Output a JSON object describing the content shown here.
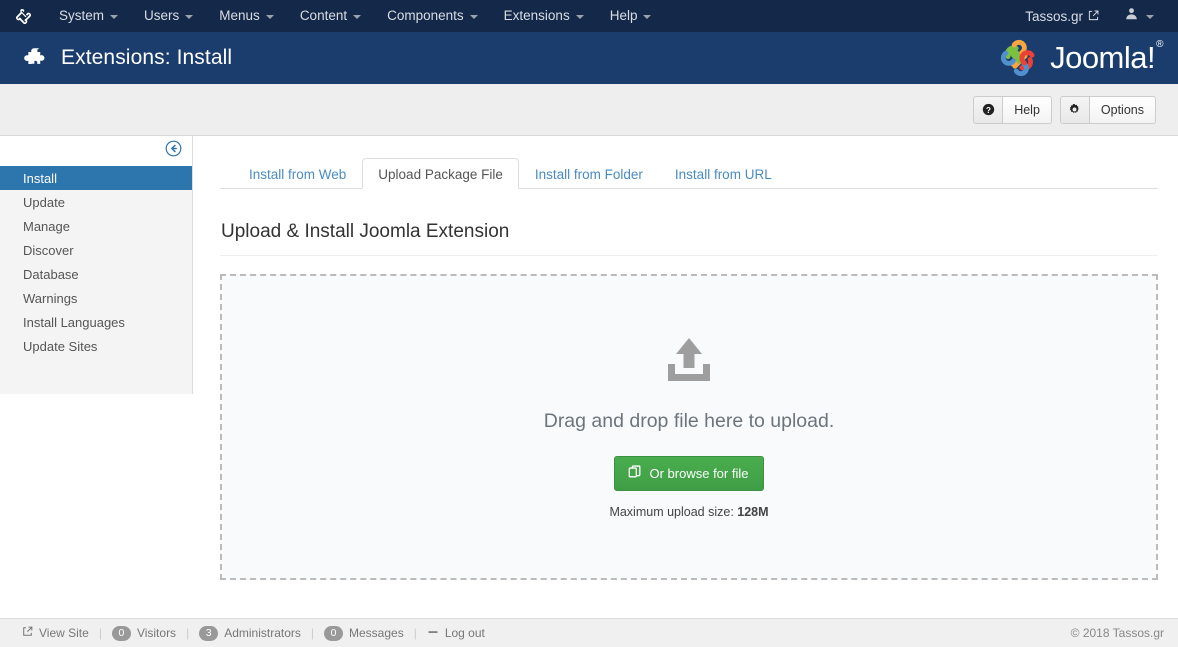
{
  "topnav": {
    "brand_icon": "joomla-mark-icon",
    "items": [
      {
        "label": "System",
        "has_caret": true
      },
      {
        "label": "Users",
        "has_caret": true
      },
      {
        "label": "Menus",
        "has_caret": true
      },
      {
        "label": "Content",
        "has_caret": true
      },
      {
        "label": "Components",
        "has_caret": true
      },
      {
        "label": "Extensions",
        "has_caret": true
      },
      {
        "label": "Help",
        "has_caret": true
      }
    ],
    "site_link": "Tassos.gr",
    "site_link_icon": "external-link-icon",
    "user_icon": "user-avatar-icon"
  },
  "header": {
    "icon": "puzzle-piece-icon",
    "title": "Extensions: Install",
    "logo_text": "Joomla!",
    "logo_registered": "®"
  },
  "toolbar": {
    "help_label": "Help",
    "help_icon": "question-circle-icon",
    "options_label": "Options",
    "options_icon": "gear-icon"
  },
  "sidebar": {
    "collapse_icon": "circle-arrow-left-icon",
    "items": [
      {
        "label": "Install",
        "active": true
      },
      {
        "label": "Update",
        "active": false
      },
      {
        "label": "Manage",
        "active": false
      },
      {
        "label": "Discover",
        "active": false
      },
      {
        "label": "Database",
        "active": false
      },
      {
        "label": "Warnings",
        "active": false
      },
      {
        "label": "Install Languages",
        "active": false
      },
      {
        "label": "Update Sites",
        "active": false
      }
    ]
  },
  "main": {
    "tabs": [
      {
        "label": "Install from Web",
        "active": false
      },
      {
        "label": "Upload Package File",
        "active": true
      },
      {
        "label": "Install from Folder",
        "active": false
      },
      {
        "label": "Install from URL",
        "active": false
      }
    ],
    "section_title": "Upload & Install Joomla Extension",
    "dropzone": {
      "upload_icon": "upload-tray-icon",
      "drop_text": "Drag and drop file here to upload.",
      "browse_label": "Or browse for file",
      "browse_icon": "copy-files-icon",
      "max_size_label": "Maximum upload size:",
      "max_size_value": "128M"
    }
  },
  "footer": {
    "view_site_label": "View Site",
    "view_site_icon": "external-link-icon",
    "visitors_count": "0",
    "visitors_label": "Visitors",
    "administrators_count": "3",
    "administrators_label": "Administrators",
    "messages_count": "0",
    "messages_label": "Messages",
    "logout_label": "Log out",
    "logout_icon": "minus-icon",
    "copyright": "© 2018 Tassos.gr"
  },
  "colors": {
    "topbar_bg": "#142849",
    "subhead_bg": "#1a3d6d",
    "sidebar_active": "#2d76ad",
    "link_blue": "#4a8bc2",
    "button_green": "#44a248"
  }
}
